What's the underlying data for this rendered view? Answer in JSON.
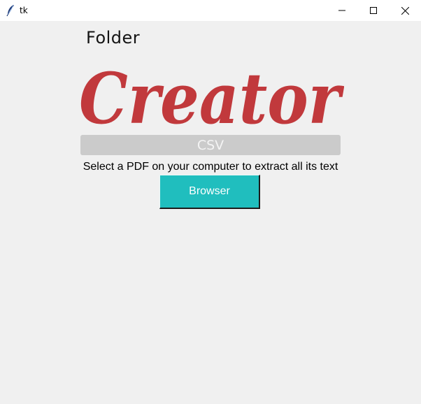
{
  "window": {
    "title": "tk",
    "icon": "tk-feather-icon",
    "controls": [
      "minimize-icon",
      "maximize-icon",
      "close-icon"
    ]
  },
  "header": {
    "folder_label": "Folder",
    "logo_text": "Creator",
    "logo_color": "#c1393c"
  },
  "csv_bar": {
    "label": "CSV",
    "background": "#cbcbcb"
  },
  "instruction": {
    "text": "Select a PDF on your computer to extract all its text"
  },
  "browse_button": {
    "label": "Browser",
    "background": "#20bebe"
  }
}
